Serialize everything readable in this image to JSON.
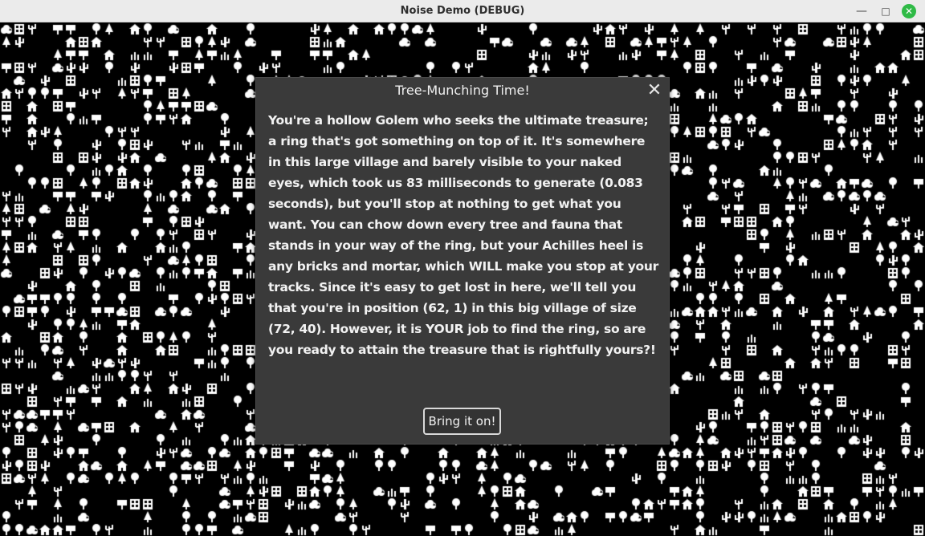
{
  "window": {
    "title": "Noise Demo (DEBUG)",
    "minimize_icon": "minimize-icon",
    "maximize_icon": "maximize-icon",
    "close_icon": "close-icon",
    "close_color": "#2fba46"
  },
  "dialog": {
    "title": "Tree-Munching Time!",
    "close_glyph": "✕",
    "body": "You're a hollow Golem who seeks the ultimate treasure; a ring that's got something on top of it. It's somewhere in this large village and barely visible to your naked eyes, which took us 83 milliseconds to generate (0.083 seconds), but you'll stop at nothing to get what you want. You can chow down every tree and fauna that stands in your way of the ring, but your Achilles heel is any bricks and mortar, which WILL make you stop at your tracks. Since it's easy to get lost in here, we'll tell you that you're in position (62, 1) in this big village of size (72, 40). However, it is YOUR job to find the ring, so are you ready to attain the treasure that is rightfully yours?!",
    "button_label": "Bring it on!"
  },
  "world": {
    "background": "#000000",
    "glyph_color": "#ffffff",
    "tile_types": [
      "tree-icon",
      "pine-icon",
      "bush-icon",
      "cactus-icon",
      "grass-icon",
      "dead-tree-icon",
      "sign-icon",
      "house-icon",
      "building-icon"
    ]
  }
}
